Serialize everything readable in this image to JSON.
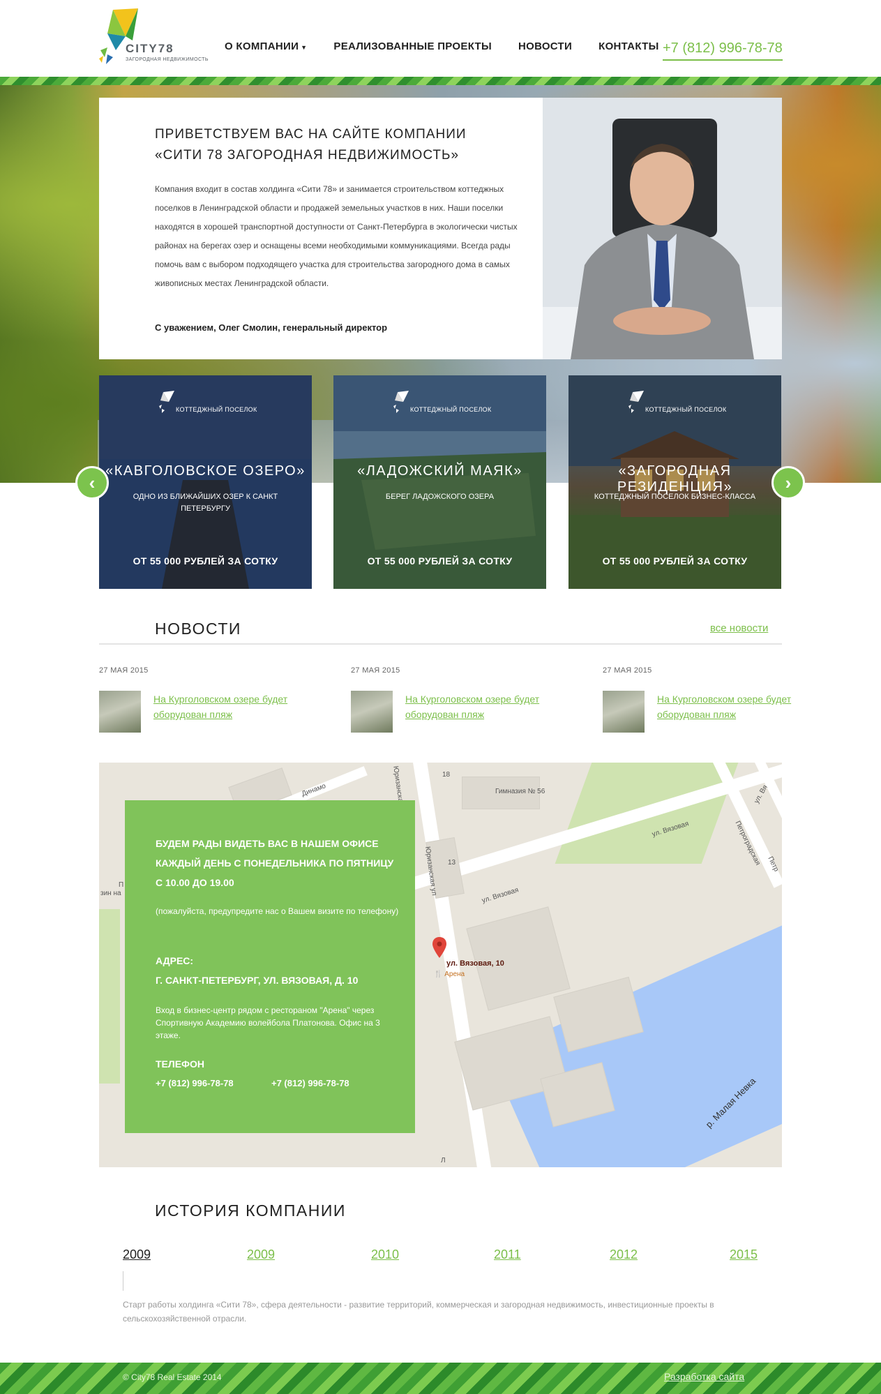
{
  "brand": {
    "logo_text": "CITY78",
    "logo_sub": "ЗАГОРОДНАЯ НЕДВИЖИМОСТЬ",
    "accent_color": "#7cbf4a",
    "logo_icon": "kite-logo-icon"
  },
  "nav": {
    "items": [
      {
        "label": "О КОМПАНИИ",
        "has_dropdown": true
      },
      {
        "label": "РЕАЛИЗОВАННЫЕ ПРОЕКТЫ"
      },
      {
        "label": "НОВОСТИ"
      },
      {
        "label": "КОНТАКТЫ"
      }
    ],
    "phone": "+7 (812) 996-78-78"
  },
  "welcome": {
    "title": "ПРИВЕТСТВУЕМ ВАС НА САЙТЕ КОМПАНИИ «СИТИ 78 ЗАГОРОДНАЯ НЕДВИЖИМОСТЬ»",
    "text": "Компания входит в состав холдинга «Сити 78» и занимается строительством коттеджных поселков в Ленинградской области и продажей земельных участков в них. Наши поселки находятся в хорошей транспортной доступности от Санкт-Петербурга в экологически чистых районах на берегах озер и оснащены всеми необходимыми коммуникациями. Всегда рады помочь вам с выбором подходящего участка для строительства загородного дома в самых живописных местах Ленинградской области.",
    "signature": "С уважением, Олег Смолин, генеральный директор"
  },
  "projects": [
    {
      "tag": "КОТТЕДЖНЫЙ ПОСЕЛОК",
      "name": "«КАВГОЛОВСКОЕ ОЗЕРО»",
      "desc": "ОДНО ИЗ БЛИЖАЙШИХ ОЗЕР К САНКТ ПЕТЕРБУРГУ",
      "price": "ОТ 55 000 РУБЛЕЙ ЗА СОТКУ"
    },
    {
      "tag": "КОТТЕДЖНЫЙ ПОСЕЛОК",
      "name": "«ЛАДОЖСКИЙ МАЯК»",
      "desc": "БЕРЕГ ЛАДОЖСКОГО ОЗЕРА",
      "price": "ОТ 55 000 РУБЛЕЙ ЗА СОТКУ"
    },
    {
      "tag": "КОТТЕДЖНЫЙ ПОСЕЛОК",
      "name": "«ЗАГОРОДНАЯ РЕЗИДЕНЦИЯ»",
      "desc": "КОТТЕДЖНЫЙ ПОСЕЛОК БИЗНЕС-КЛАССА",
      "price": "ОТ 55 000 РУБЛЕЙ ЗА СОТКУ"
    }
  ],
  "slider": {
    "prev": "‹",
    "next": "›"
  },
  "news": {
    "title": "НОВОСТИ",
    "all_link": "все новости",
    "items": [
      {
        "date": "27 МАЯ 2015",
        "text": "На Курголовском озере будет оборудован пляж"
      },
      {
        "date": "27 МАЯ 2015",
        "text": "На Курголовском озере будет оборудован пляж"
      },
      {
        "date": "27 МАЯ 2015",
        "text": "На Курголовском озере будет оборудован пляж"
      }
    ]
  },
  "map": {
    "labels": [
      "Динамо",
      "Юризанская",
      "18",
      "Гимназия № 56",
      "ул. Вязовая",
      "Петроградская",
      "13",
      "Юризанская ул",
      "ул. Вязовая",
      "зин на",
      "П",
      "ул. Вя",
      "Петр",
      "р. Малая Невка",
      "Л"
    ],
    "pin_address": "ул. Вязовая, 10",
    "poi": "Арена"
  },
  "office": {
    "heading": "БУДЕМ РАДЫ ВИДЕТЬ ВАС В НАШЕМ ОФИСЕ КАЖДЫЙ ДЕНЬ С ПОНЕДЕЛЬНИКА ПО ПЯТНИЦУ С 10.00 ДО 19.00",
    "note": "(пожалуйста, предупредите нас о Вашем визите по телефону)",
    "address_label": "АДРЕС:",
    "address": "Г. САНКТ-ПЕТЕРБУРГ, УЛ. ВЯЗОВАЯ, Д. 10",
    "entry": "Вход в бизнес-центр рядом с рестораном \"Арена\" через Спортивную Академию волейбола Платонова. Офис на 3 этаже.",
    "phone_label": "ТЕЛЕФОН",
    "phones": [
      "+7 (812) 996-78-78",
      "+7 (812) 996-78-78"
    ]
  },
  "history": {
    "title": "ИСТОРИЯ КОМПАНИИ",
    "years": [
      "2009",
      "2009",
      "2010",
      "2011",
      "2012",
      "2015"
    ],
    "active_index": 0,
    "text": "Старт работы холдинга «Сити 78», сфера деятельности - развитие территорий, коммерческая и загородная недвижимость, инвестиционные проекты в сельскохозяйственной отрасли."
  },
  "footer": {
    "copyright": "© City78 Real Estate 2014",
    "dev_link": "Разработка сайта"
  }
}
